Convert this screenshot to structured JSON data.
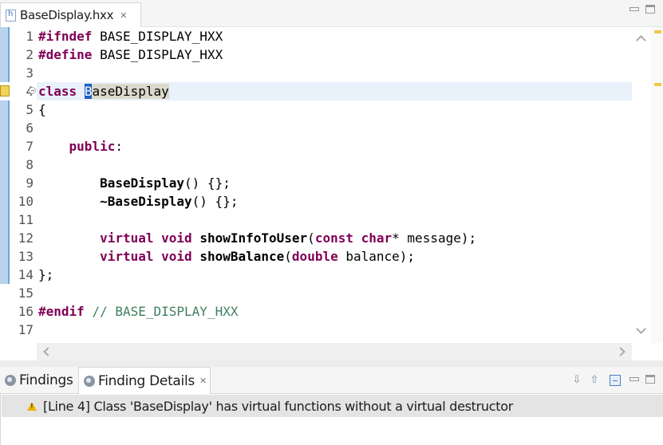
{
  "editor": {
    "tab": {
      "label": "BaseDisplay.hxx",
      "close": "✕"
    },
    "code": {
      "line_numbers": [
        "1",
        "2",
        "3",
        "4",
        "5",
        "6",
        "7",
        "8",
        "9",
        "10",
        "11",
        "12",
        "13",
        "14",
        "15",
        "16",
        "17"
      ],
      "lines": [
        [
          {
            "t": "#ifndef",
            "c": "kw"
          },
          {
            "t": " BASE_DISPLAY_HXX"
          }
        ],
        [
          {
            "t": "#define",
            "c": "kw"
          },
          {
            "t": " BASE_DISPLAY_HXX"
          }
        ],
        [],
        [
          {
            "t": "class",
            "c": "kw"
          },
          {
            "t": " "
          },
          {
            "t": "B",
            "c": "occurrence caret-char"
          },
          {
            "t": "aseDisplay",
            "c": "occurrence"
          }
        ],
        [
          {
            "t": "{"
          }
        ],
        [],
        [
          {
            "t": "    "
          },
          {
            "t": "public",
            "c": "kw"
          },
          {
            "t": ":"
          }
        ],
        [],
        [
          {
            "t": "        "
          },
          {
            "t": "BaseDisplay",
            "c": "bold"
          },
          {
            "t": "() {};"
          }
        ],
        [
          {
            "t": "        "
          },
          {
            "t": "~BaseDisplay",
            "c": "bold"
          },
          {
            "t": "() {};"
          }
        ],
        [],
        [
          {
            "t": "        "
          },
          {
            "t": "virtual",
            "c": "kw"
          },
          {
            "t": " "
          },
          {
            "t": "void",
            "c": "kw"
          },
          {
            "t": " "
          },
          {
            "t": "showInfoToUser",
            "c": "bold"
          },
          {
            "t": "("
          },
          {
            "t": "const",
            "c": "kw"
          },
          {
            "t": " "
          },
          {
            "t": "char",
            "c": "kw"
          },
          {
            "t": "* message);"
          }
        ],
        [
          {
            "t": "        "
          },
          {
            "t": "virtual",
            "c": "kw"
          },
          {
            "t": " "
          },
          {
            "t": "void",
            "c": "kw"
          },
          {
            "t": " "
          },
          {
            "t": "showBalance",
            "c": "bold"
          },
          {
            "t": "("
          },
          {
            "t": "double",
            "c": "kw"
          },
          {
            "t": " balance);"
          }
        ],
        [
          {
            "t": "};"
          }
        ],
        [],
        [
          {
            "t": "#endif",
            "c": "kw"
          },
          {
            "t": " "
          },
          {
            "t": "// BASE_DISPLAY_HXX",
            "c": "cm"
          }
        ],
        []
      ]
    }
  },
  "panel": {
    "tabs": [
      {
        "label": "Findings"
      },
      {
        "label": "Finding Details",
        "close": "✕"
      }
    ],
    "tools": {
      "down": "⇩",
      "up": "⇧"
    },
    "finding": "[Line 4] Class 'BaseDisplay' has virtual functions without a virtual destructor"
  }
}
